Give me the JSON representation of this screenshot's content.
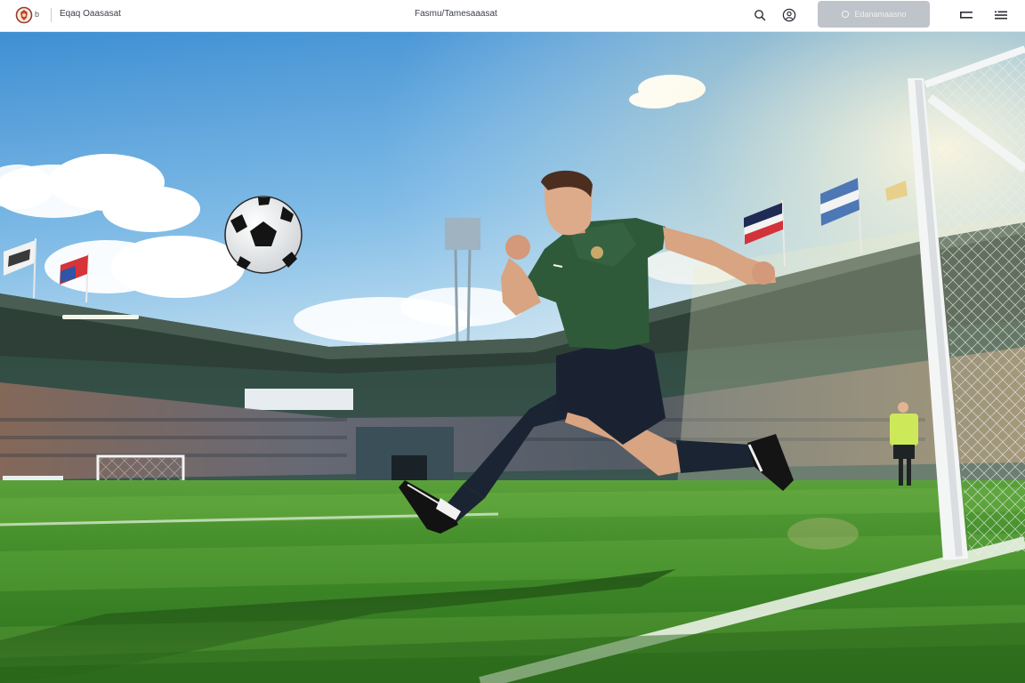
{
  "header": {
    "logo_mark": "b",
    "site_name": "Eqaq Oaasasat",
    "page_title": "Fasmu/Tamesaaasat",
    "cta_label": "Edanamaasno"
  },
  "icons": {
    "logo": "club-crest-icon",
    "search": "search-icon",
    "profile": "profile-icon",
    "cta": "sparkle-icon",
    "menu_a": "panel-toggle-icon",
    "menu_b": "menu-list-icon"
  },
  "colors": {
    "topbar_bg": "#ffffff",
    "cta_bg": "#bfc4cb",
    "jersey": "#2f5a3a",
    "pitch": "#3d8a2a",
    "sky": "#5aa3dc"
  }
}
